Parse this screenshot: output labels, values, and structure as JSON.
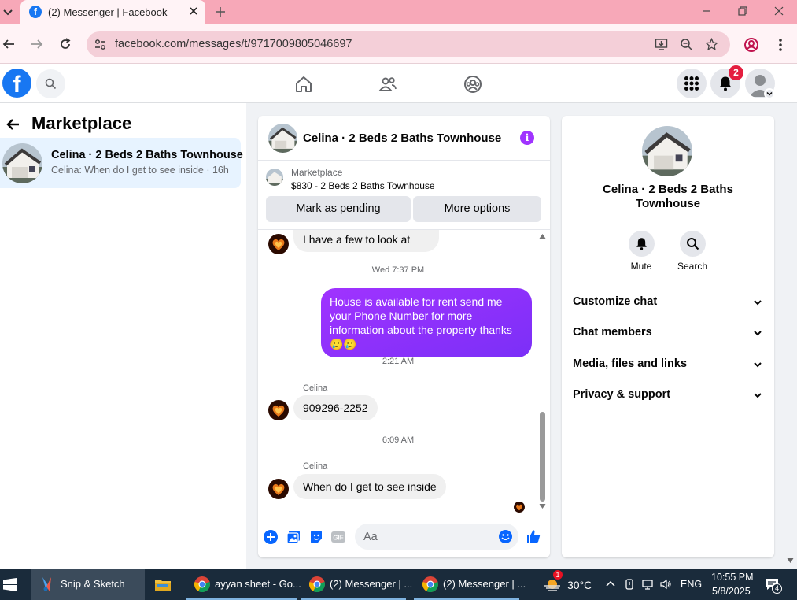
{
  "browser": {
    "tab_title": "(2) Messenger | Facebook",
    "url": "facebook.com/messages/t/9717009805046697"
  },
  "fb_nav": {
    "logo": "f",
    "notification_count": "2"
  },
  "sidebar": {
    "title": "Marketplace",
    "threads": [
      {
        "name": "Celina · 2 Beds 2 Baths Townhouse",
        "preview": "Celina: When do I get to see inside · 16h"
      }
    ]
  },
  "chat": {
    "title": "Celina · 2 Beds 2 Baths Townhouse",
    "info_glyph": "i",
    "listing": {
      "label": "Marketplace",
      "price_title": "$830 - 2 Beds 2 Baths Townhouse",
      "mark_pending": "Mark as pending",
      "more_options": "More options"
    },
    "messages": [
      {
        "type": "incoming",
        "text": "I have a few to look at"
      },
      {
        "type": "timestamp",
        "text": "Wed 7:37 PM"
      },
      {
        "type": "outgoing",
        "text": "House is available for rent send me your Phone Number for more information about the property thanks 🥲🥲"
      },
      {
        "type": "timestamp",
        "text": "2:21 AM"
      },
      {
        "type": "sender",
        "text": "Celina"
      },
      {
        "type": "incoming",
        "text": "909296-2252"
      },
      {
        "type": "timestamp",
        "text": "6:09 AM"
      },
      {
        "type": "sender",
        "text": "Celina"
      },
      {
        "type": "incoming",
        "text": "When do I get to see inside"
      }
    ],
    "composer_placeholder": "Aa",
    "gif_label": "GIF"
  },
  "info_panel": {
    "name": "Celina · 2 Beds 2 Baths Townhouse",
    "actions": [
      {
        "label": "Mute",
        "icon": "bell-icon"
      },
      {
        "label": "Search",
        "icon": "search-icon"
      }
    ],
    "sections": [
      "Customize chat",
      "Chat members",
      "Media, files and links",
      "Privacy & support"
    ]
  },
  "taskbar": {
    "items": [
      {
        "label": "Snip & Sketch"
      },
      {
        "label": ""
      },
      {
        "label": "ayyan sheet - Go..."
      },
      {
        "label": "(2) Messenger | ..."
      },
      {
        "label": "(2) Messenger | ..."
      }
    ],
    "weather": "30°C",
    "weather_badge": "1",
    "language": "ENG",
    "time": "10:55 PM",
    "date": "5/8/2025",
    "notifications": "4"
  },
  "colors": {
    "accent": "#a033ff",
    "fb_blue": "#1877f2",
    "tab_strip": "#f7a8b8",
    "selected_thread": "#e7f3ff"
  }
}
